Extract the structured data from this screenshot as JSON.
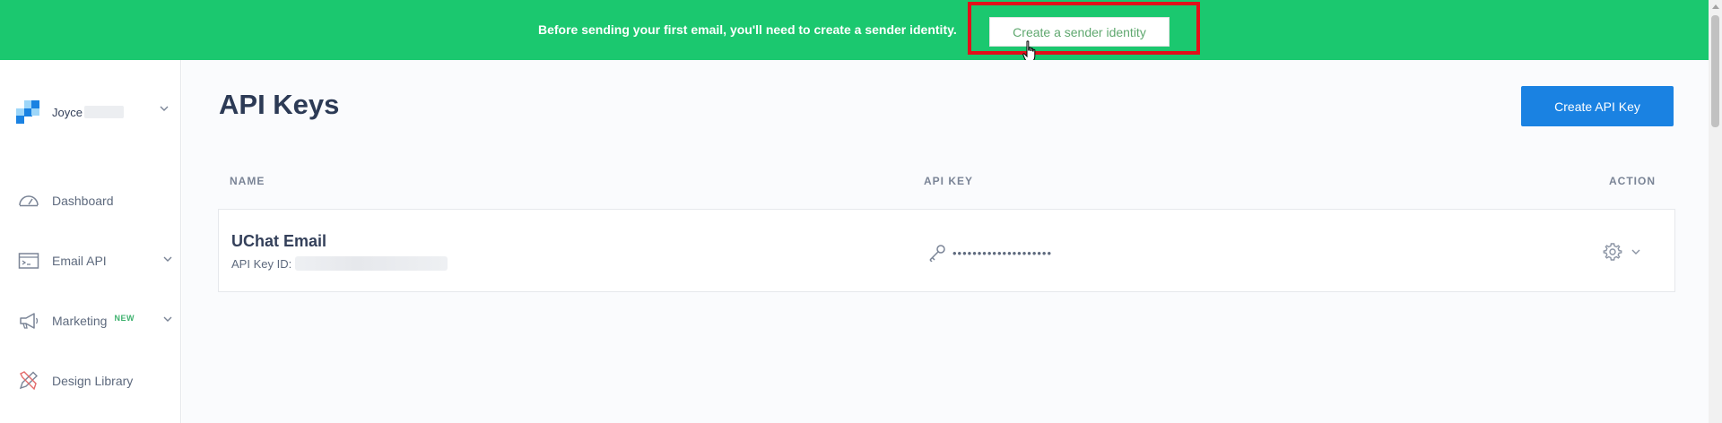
{
  "banner": {
    "message": "Before sending your first email, you'll need to create a sender identity.",
    "button_label": "Create a sender identity",
    "bg_color": "#1bc86f",
    "highlight_color": "#e3101a"
  },
  "sidebar": {
    "account_name": "Joyce",
    "items": [
      {
        "label": "Dashboard",
        "icon": "gauge-icon"
      },
      {
        "label": "Email API",
        "icon": "terminal-icon"
      },
      {
        "label": "Marketing",
        "icon": "megaphone-icon",
        "badge": "NEW"
      },
      {
        "label": "Design Library",
        "icon": "design-tools-icon"
      }
    ]
  },
  "main": {
    "title": "API Keys",
    "create_button": "Create API Key",
    "accent_color": "#1a82e2",
    "columns": {
      "name": "NAME",
      "api_key": "API KEY",
      "action": "ACTION"
    },
    "rows": [
      {
        "name": "UChat Email",
        "id_label": "API Key ID:",
        "masked_key": "••••••••••••••••••••"
      }
    ]
  }
}
